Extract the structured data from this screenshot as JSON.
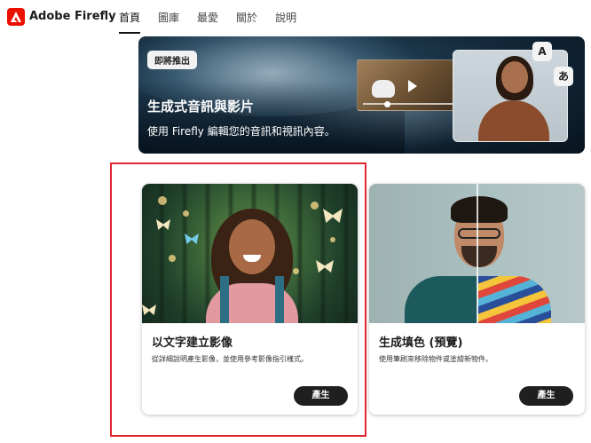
{
  "app": {
    "brand_name": "Adobe Firefly",
    "accent_color": "#eb1000"
  },
  "nav": {
    "items": [
      {
        "label": "首頁",
        "active": true
      },
      {
        "label": "圖庫",
        "active": false
      },
      {
        "label": "最愛",
        "active": false
      },
      {
        "label": "關於",
        "active": false
      },
      {
        "label": "說明",
        "active": false
      }
    ]
  },
  "banner": {
    "badge": "即將推出",
    "title": "生成式音訊與影片",
    "subtitle": "使用 Firefly 編輯您的音訊和視訊內容。",
    "lang_bubble_a": "A",
    "lang_bubble_ja": "あ"
  },
  "cards": [
    {
      "title": "以文字建立影像",
      "description": "從詳細說明產生影像，並使用參考影像指引樣式。",
      "button": "產生",
      "highlighted": true
    },
    {
      "title": "生成填色 (預覽)",
      "description": "使用筆刷來移除物件或塗繪新物件。",
      "button": "產生",
      "highlighted": false
    }
  ]
}
